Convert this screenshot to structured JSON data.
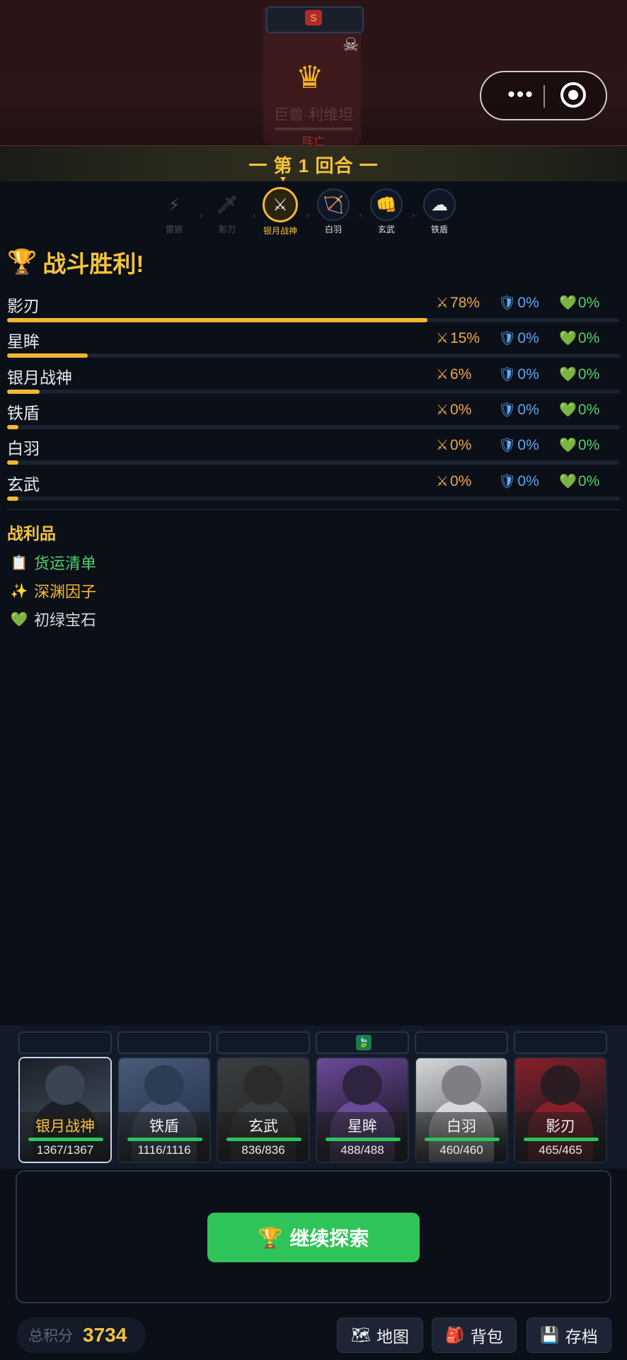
{
  "boss": {
    "status_icon": "S",
    "skull_icon": "skull-icon",
    "crown_icon": "crown-icon",
    "name": "巨兽·利维坦",
    "state": "阵亡"
  },
  "capsule": {
    "more": "•••"
  },
  "round": {
    "label": "一 第 1 回合 一"
  },
  "turn_order": [
    {
      "label": "雷狼",
      "icon": "⚡",
      "state": "past"
    },
    {
      "label": "影刃",
      "icon": "🗡",
      "state": "past"
    },
    {
      "label": "银月战神",
      "icon": "⚔",
      "state": "active"
    },
    {
      "label": "白羽",
      "icon": "🏹",
      "state": "upcoming"
    },
    {
      "label": "玄武",
      "icon": "👊",
      "state": "upcoming"
    },
    {
      "label": "铁盾",
      "icon": "☁",
      "state": "upcoming"
    }
  ],
  "victory": {
    "trophy": "🏆",
    "title": "战斗胜利!",
    "stats": [
      {
        "name": "影刃",
        "damage": "78%",
        "defense": "0%",
        "heal": "0%",
        "damage_share": 0.78
      },
      {
        "name": "星眸",
        "damage": "15%",
        "defense": "0%",
        "heal": "0%",
        "damage_share": 0.15
      },
      {
        "name": "银月战神",
        "damage": "6%",
        "defense": "0%",
        "heal": "0%",
        "damage_share": 0.06
      },
      {
        "name": "铁盾",
        "damage": "0%",
        "defense": "0%",
        "heal": "0%",
        "damage_share": 0.0
      },
      {
        "name": "白羽",
        "damage": "0%",
        "defense": "0%",
        "heal": "0%",
        "damage_share": 0.0
      },
      {
        "name": "玄武",
        "damage": "0%",
        "defense": "0%",
        "heal": "0%",
        "damage_share": 0.0
      }
    ],
    "icons": {
      "damage": "⚔",
      "defense": "🛡",
      "heal": "💚"
    }
  },
  "loot": {
    "title": "战利品",
    "items": [
      {
        "icon": "📋",
        "name": "货运清单",
        "color": "#4fd06f"
      },
      {
        "icon": "✨",
        "name": "深渊因子",
        "color": "#f5b731"
      },
      {
        "icon": "💚",
        "name": "初绿宝石",
        "color": "#d8d8d8"
      }
    ]
  },
  "team": [
    {
      "name": "银月战神",
      "hp": "1367/1367",
      "hp_ratio": 1.0,
      "selected": true,
      "badge": "",
      "tone": "#3a4452",
      "accent": "#1b1f26"
    },
    {
      "name": "铁盾",
      "hp": "1116/1116",
      "hp_ratio": 1.0,
      "selected": false,
      "badge": "",
      "tone": "#2d3c55",
      "accent": "#4a5a78"
    },
    {
      "name": "玄武",
      "hp": "836/836",
      "hp_ratio": 1.0,
      "selected": false,
      "badge": "",
      "tone": "#2a2c2e",
      "accent": "#3b3e40"
    },
    {
      "name": "星眸",
      "hp": "488/488",
      "hp_ratio": 1.0,
      "selected": false,
      "badge": "🍃",
      "tone": "#2f2440",
      "accent": "#6b4a9a"
    },
    {
      "name": "白羽",
      "hp": "460/460",
      "hp_ratio": 1.0,
      "selected": false,
      "badge": "",
      "tone": "#7d7f84",
      "accent": "#d6d8dc"
    },
    {
      "name": "影刃",
      "hp": "465/465",
      "hp_ratio": 1.0,
      "selected": false,
      "badge": "",
      "tone": "#2a1c22",
      "accent": "#8a1f2a"
    }
  ],
  "actions": {
    "continue_icon": "🏆",
    "continue_label": "继续探索"
  },
  "footer": {
    "score_label": "总积分",
    "score_value": "3734",
    "map_icon": "🗺",
    "map_label": "地图",
    "bag_icon": "🎒",
    "bag_label": "背包",
    "save_icon": "💾",
    "save_label": "存档"
  }
}
